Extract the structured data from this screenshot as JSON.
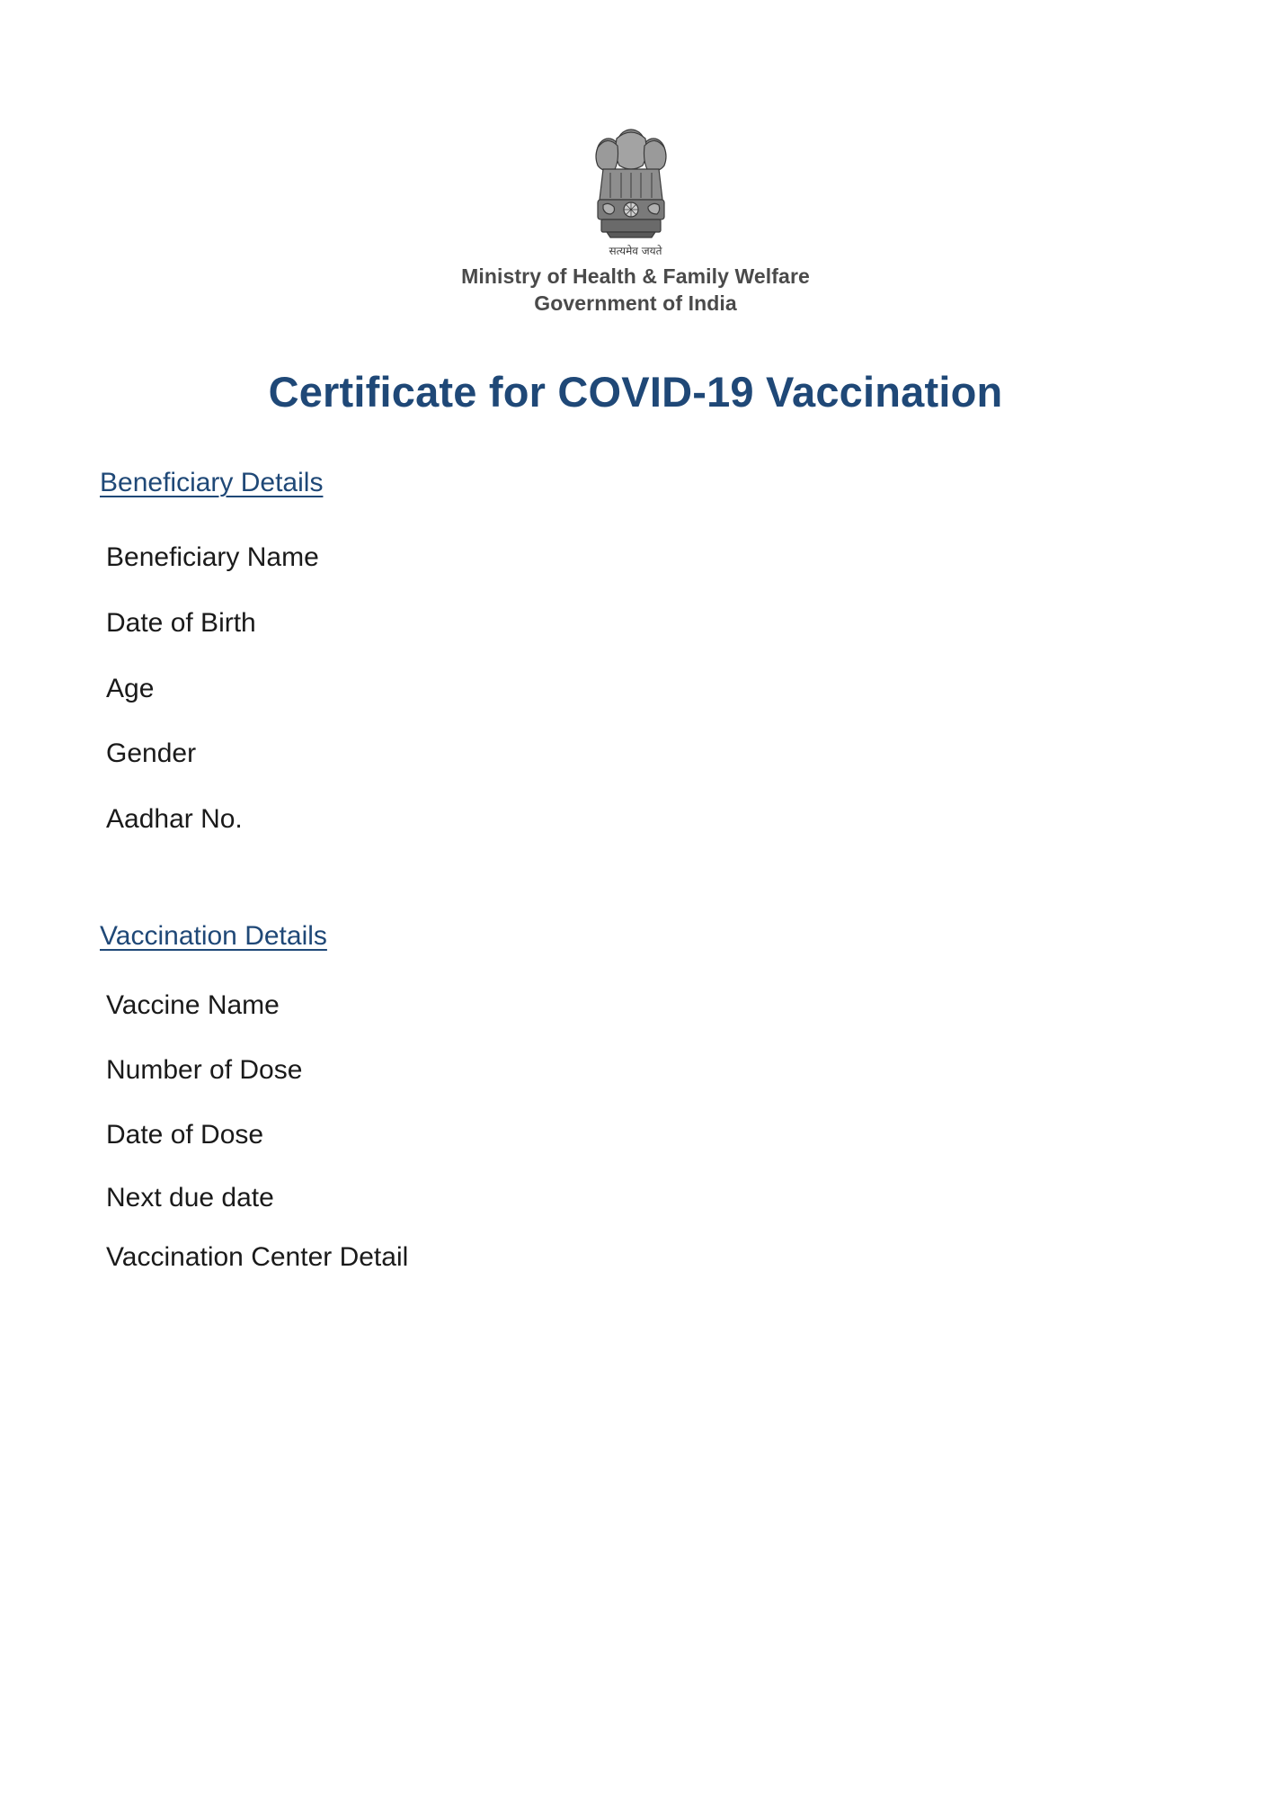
{
  "header": {
    "emblem_icon": "state-emblem-of-india-icon",
    "emblem_motto": "सत्यमेव जयते",
    "ministry_line1": "Ministry of Health & Family Welfare",
    "ministry_line2": "Government of India"
  },
  "title": "Certificate for COVID-19 Vaccination",
  "beneficiary": {
    "heading": "Beneficiary Details",
    "fields": [
      "Beneficiary Name",
      "Date of Birth",
      "Age",
      "Gender",
      "Aadhar No."
    ]
  },
  "vaccination": {
    "heading": "Vaccination Details",
    "fields": [
      "Vaccine Name",
      "Number of Dose",
      "Date of Dose",
      "Next due date",
      "Vaccination Center Detail"
    ]
  },
  "colors": {
    "accent": "#1f4877",
    "text": "#1a1a1a",
    "ministry_text": "#4a4a4a"
  }
}
